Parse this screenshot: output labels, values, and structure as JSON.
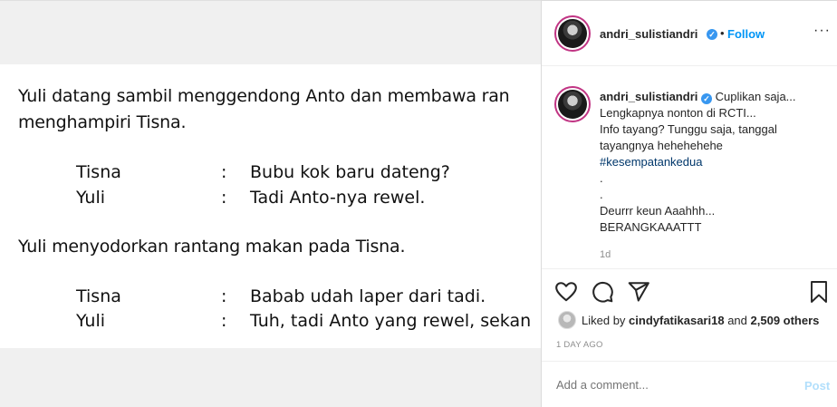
{
  "post_image": {
    "narration_1": "Yuli datang sambil menggendong Anto dan membawa ran",
    "narration_1b": "menghampiri Tisna.",
    "dialog_1": [
      {
        "speaker": "Tisna",
        "colon": ":",
        "line": "Bubu kok baru dateng?"
      },
      {
        "speaker": "Yuli",
        "colon": ":",
        "line": "Tadi Anto-nya rewel."
      }
    ],
    "narration_2": "Yuli menyodorkan rantang makan pada Tisna.",
    "dialog_2": [
      {
        "speaker": "Tisna",
        "colon": ":",
        "line": "Babab udah laper dari tadi."
      },
      {
        "speaker": "Yuli",
        "colon": ":",
        "line": "Tuh, tadi Anto yang rewel, sekan"
      }
    ]
  },
  "header": {
    "username": "andri_sulistiandri",
    "separator": "•",
    "follow_label": "Follow",
    "more_label": "···"
  },
  "caption": {
    "username": "andri_sulistiandri",
    "lines": [
      "Cuplikan saja...",
      "Lengkapnya nonton di RCTI...",
      "Info tayang? Tunggu saja, tanggal",
      "tayangnya hehehehehe"
    ],
    "hashtag": "#kesempatankedua",
    "dots": [
      ".",
      "."
    ],
    "closing": [
      "Deurrr keun Aaahhh...",
      "BERANGKAAATTT"
    ],
    "age": "1d"
  },
  "icons": {
    "like": "heart-icon",
    "comment": "comment-icon",
    "share": "share-icon",
    "save": "bookmark-icon",
    "verified": "verified-badge-icon"
  },
  "likes": {
    "prefix": "Liked by",
    "user": "cindyfatikasari18",
    "middle": "and",
    "others": "2,509 others"
  },
  "timestamp": "1 DAY AGO",
  "comment": {
    "placeholder": "Add a comment...",
    "post_label": "Post"
  },
  "colors": {
    "follow": "#0095f6",
    "hashtag": "#00376b",
    "post_disabled": "#b2dffc",
    "verified": "#3897f0"
  }
}
